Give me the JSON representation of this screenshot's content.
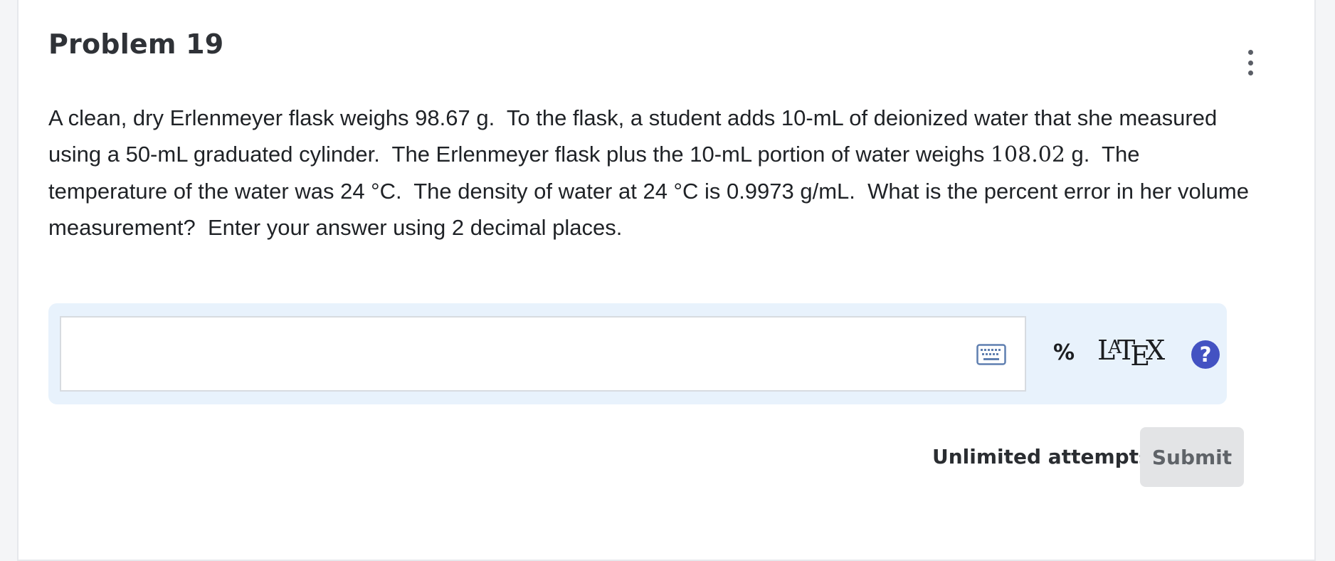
{
  "problem": {
    "title": "Problem 19",
    "text_lines": [
      "A clean, dry Erlenmeyer flask weighs 98.67 g.  To the flask, a student adds 10-mL of deionized water that she measured",
      "using a 50-mL graduated cylinder.  The Erlenmeyer flask plus the 10-mL portion of water weighs ",
      "temperature of the water was 24 °C.  The density of water at 24 °C is 0.9973 g/mL.  What is the percent error in her volume",
      "measurement?  Enter your answer using 2 decimal places."
    ],
    "math_value": "108.02",
    "line2_suffix": " g.  The"
  },
  "answer": {
    "input_value": "",
    "unit": "%",
    "latex_label": "LaTeX",
    "help_label": "?"
  },
  "footer": {
    "attempts": "Unlimited attempts",
    "submit_label": "Submit"
  },
  "icons": {
    "menu": "more-vertical-icon",
    "keyboard": "keyboard-icon",
    "help": "help-icon"
  },
  "colors": {
    "panel_bg": "#e8f2fc",
    "help_accent": "#4352c2",
    "submit_bg": "#e3e4e6"
  }
}
